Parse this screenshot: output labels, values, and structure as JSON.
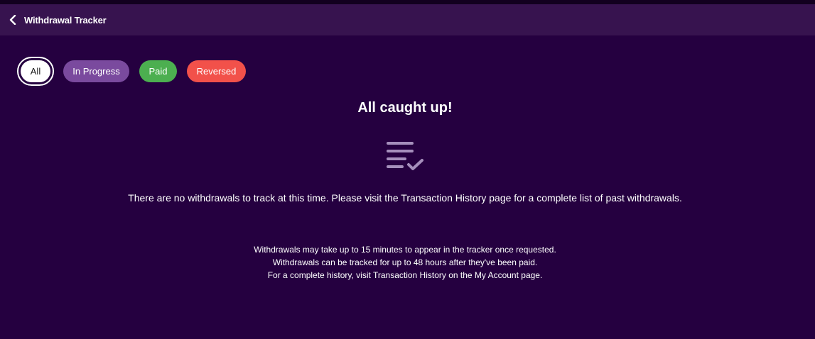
{
  "header": {
    "back_icon": "chevron-left-icon",
    "title": "Withdrawal Tracker"
  },
  "filters": [
    {
      "label": "All",
      "selected": true,
      "color": "#ffffff"
    },
    {
      "label": "In Progress",
      "selected": false,
      "color": "#7a4a9e"
    },
    {
      "label": "Paid",
      "selected": false,
      "color": "#4caf50"
    },
    {
      "label": "Reversed",
      "selected": false,
      "color": "#f2514a"
    }
  ],
  "empty_state": {
    "title": "All caught up!",
    "icon": "list-check-icon",
    "message": "There are no withdrawals to track at this time. Please visit the Transaction History page for a complete list of past withdrawals."
  },
  "notes": [
    "Withdrawals may take up to 15 minutes to appear in the tracker once requested.",
    "Withdrawals can be tracked for up to 48 hours after they've been paid.",
    "For a complete history, visit Transaction History on the My Account page."
  ],
  "colors": {
    "background": "#250040",
    "header": "#37134f",
    "icon": "#a58fbc"
  }
}
